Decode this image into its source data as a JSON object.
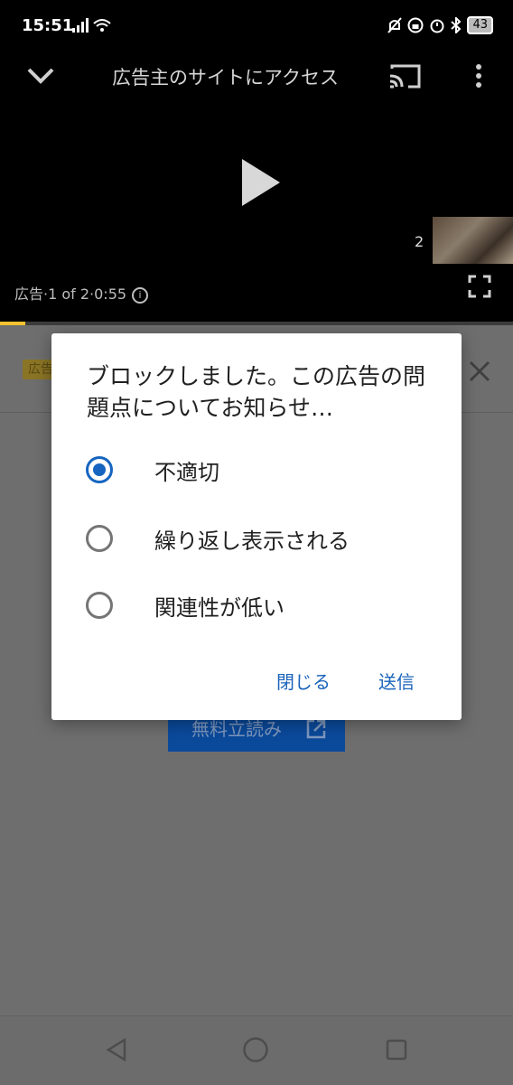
{
  "status_bar": {
    "time": "15:51",
    "battery": "43"
  },
  "player": {
    "title": "広告主のサイトにアクセス",
    "thumbnail_count": "2",
    "ad_info": "広告·1 of 2·0:55",
    "progress": 0.05
  },
  "panel": {
    "badge": "広告",
    "cta_label": "無料立読み"
  },
  "dialog": {
    "title": "ブロックしました。この広告の問題点についてお知らせ…",
    "options": [
      {
        "label": "不適切",
        "selected": true
      },
      {
        "label": "繰り返し表示される",
        "selected": false
      },
      {
        "label": "関連性が低い",
        "selected": false
      }
    ],
    "close_label": "閉じる",
    "submit_label": "送信"
  },
  "colors": {
    "accent": "#1565c0",
    "progress": "#f2c230"
  }
}
